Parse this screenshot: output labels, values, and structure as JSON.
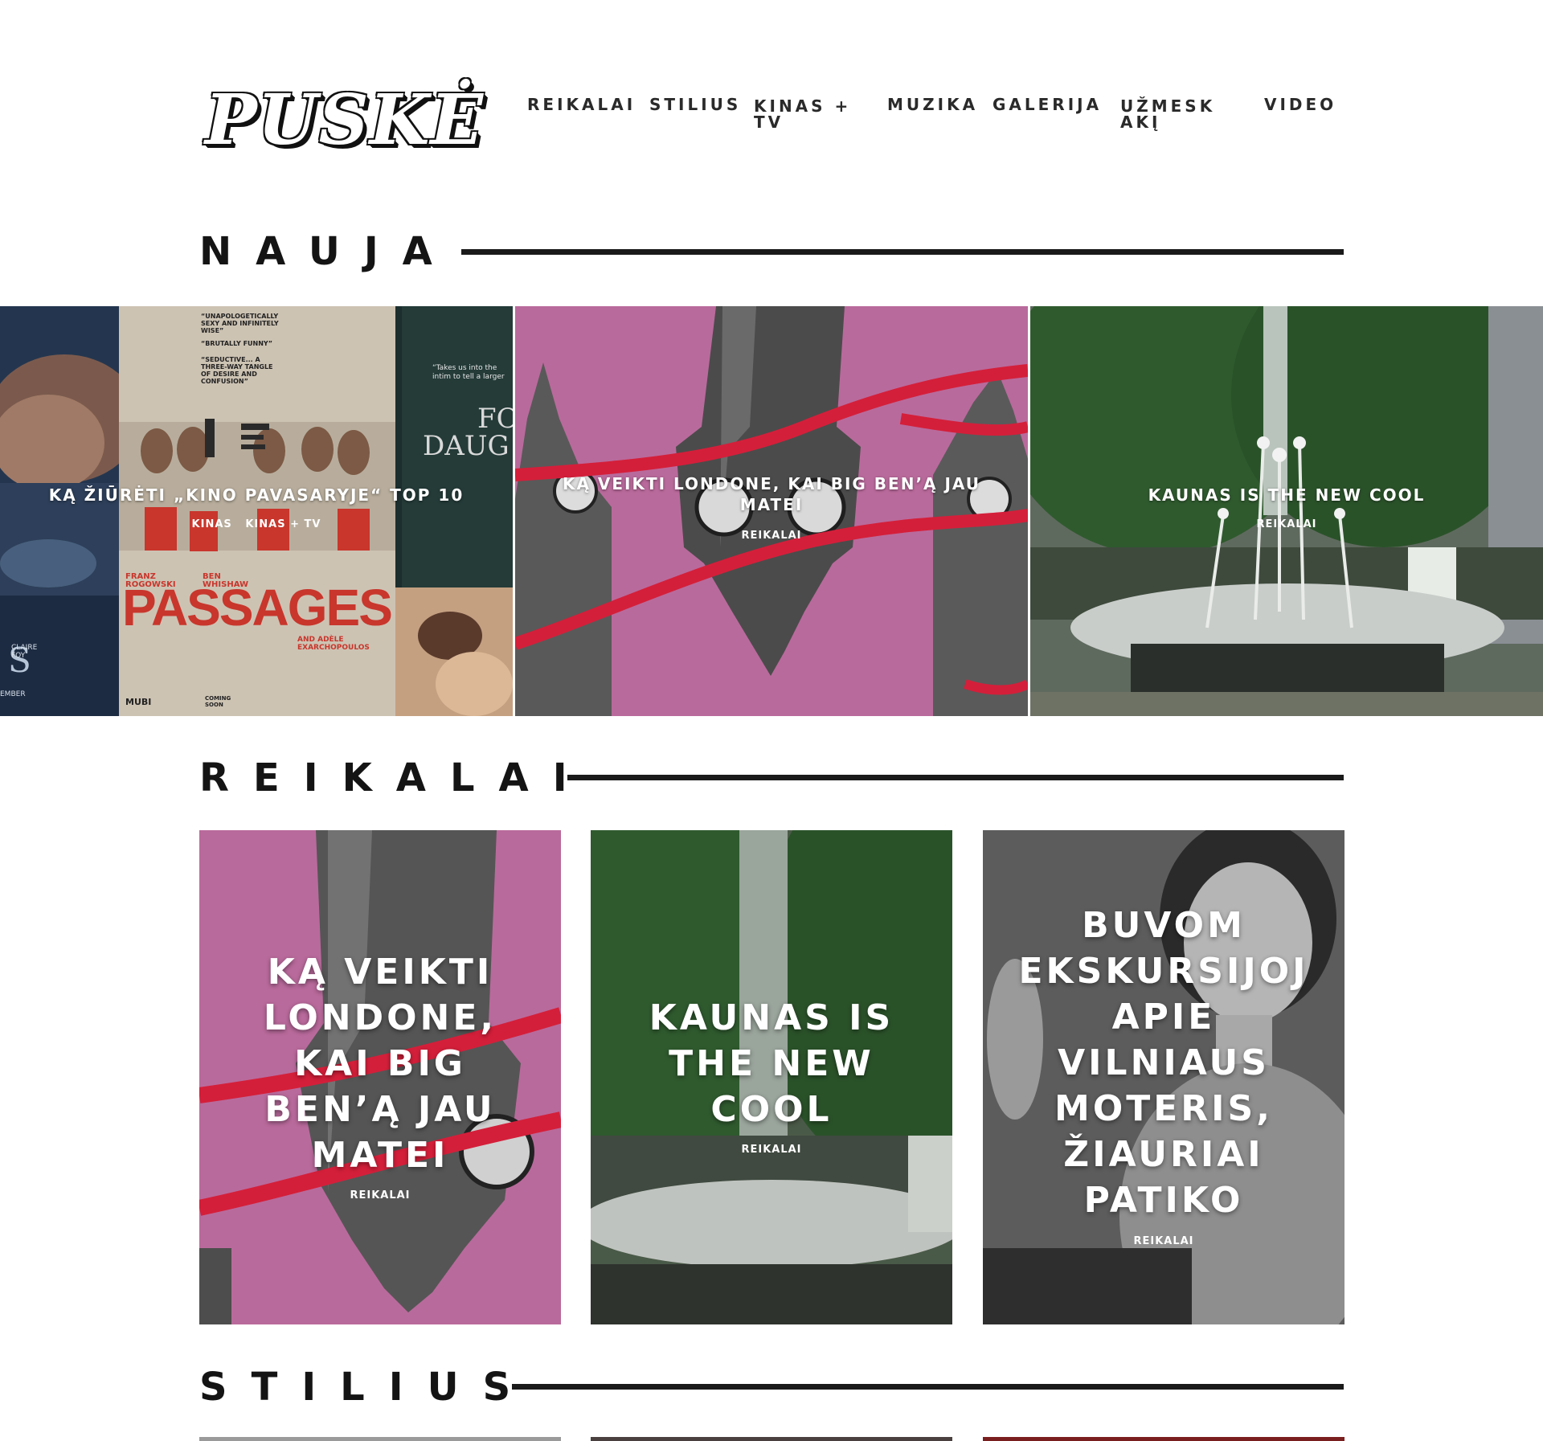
{
  "brand": {
    "logo": "PUSKĖ"
  },
  "nav": {
    "reikalai": "REIKALAI",
    "stilius": "STILIUS",
    "kinas_line1": "KINAS +",
    "kinas_line2": "TV",
    "muzika": "MUZIKA",
    "galerija": "GALERIJA",
    "uzmesk_line1": "UŽMESK",
    "uzmesk_line2": "AKĮ",
    "video": "VIDEO"
  },
  "sections": {
    "nauja": "NAUJA",
    "reikalai": "REIKALAI",
    "stilius": "STILIUS"
  },
  "slider": [
    {
      "title": "KĄ ŽIŪRĖTI „KINO PAVASARYJE“ TOP 10",
      "categories": "KINAS   KINAS + TV"
    },
    {
      "title_line1": "KĄ VEIKTI LONDONE, KAI BIG BEN’Ą JAU",
      "title_line2": "MATEI",
      "categories": "REIKALAI"
    },
    {
      "title": "KAUNAS IS THE NEW COOL",
      "categories": "REIKALAI"
    }
  ],
  "poster": {
    "quote1": "“UNAPOLOGETICALLY SEXY AND INFINITELY WISE”",
    "quote2": "“BRUTALLY FUNNY”",
    "quote3": "“SEDUCTIVE... A THREE-WAY TANGLE OF DESIRE AND CONFUSION”",
    "actor1": "FRANZ ROGOWSKI",
    "actor2": "BEN WHISHAW",
    "title": "PASSAGES",
    "actor3": "AND ADÈLE EXARCHOPOULOS",
    "studio": "MUBI",
    "coming": "COMING SOON",
    "side_quote": "“Takes us into the intim to tell a larger",
    "side_title1": "FO",
    "side_title2": "DAUG",
    "left_foy": "CLAIRE FOY",
    "left_ember": "EMBER"
  },
  "cards": [
    {
      "title": "KĄ VEIKTI LONDONE, KAI BIG BEN’Ą JAU MATEI",
      "category": "REIKALAI"
    },
    {
      "title": "KAUNAS IS THE NEW COOL",
      "category": "REIKALAI"
    },
    {
      "title": "BUVOM EKSKURSIJOJ APIE VILNIAUS MOTERIS, ŽIAURIAI PATIKO",
      "category": "REIKALAI"
    }
  ],
  "colors": {
    "pink": "#b96a9c",
    "red_ribbon": "#d41f3a",
    "tree_green": "#2f5a2e",
    "poster_beige": "#cdc3b3",
    "poster_red": "#c8362c",
    "ink": "#1a1a1a"
  },
  "icons": [
    "clock-icon"
  ]
}
